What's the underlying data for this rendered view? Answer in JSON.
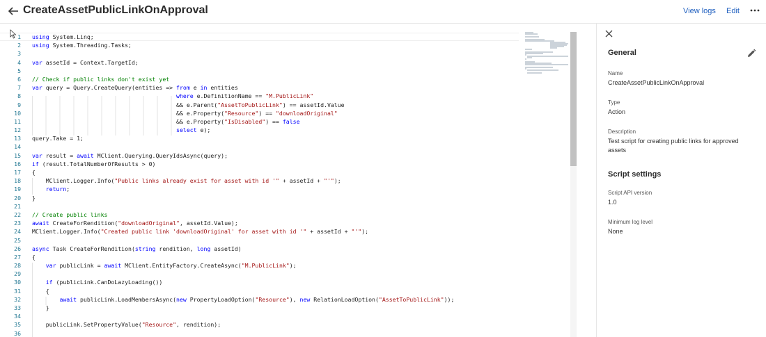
{
  "header": {
    "title": "CreateAssetPublicLinkOnApproval",
    "view_logs": "View logs",
    "edit": "Edit"
  },
  "icons": {
    "back": "arrow-left-icon",
    "more": "more-horizontal-icon",
    "close": "close-icon",
    "edit": "pencil-icon",
    "cursor": "mouse-pointer-icon"
  },
  "editor": {
    "lines": [
      {
        "n": "1",
        "t": "using System.Linq;"
      },
      {
        "n": "2",
        "t": "using System.Threading.Tasks;"
      },
      {
        "n": "3",
        "t": ""
      },
      {
        "n": "4",
        "t": "var assetId = Context.TargetId;"
      },
      {
        "n": "5",
        "t": ""
      },
      {
        "n": "6",
        "t": "// Check if public links don't exist yet"
      },
      {
        "n": "7",
        "t": "var query = Query.CreateQuery(entities => from e in entities"
      },
      {
        "n": "8",
        "t": "                                          where e.DefinitionName == \"M.PublicLink\""
      },
      {
        "n": "9",
        "t": "                                          && e.Parent(\"AssetToPublicLink\") == assetId.Value"
      },
      {
        "n": "10",
        "t": "                                          && e.Property(\"Resource\") == \"downloadOriginal\""
      },
      {
        "n": "11",
        "t": "                                          && e.Property(\"IsDisabled\") == false"
      },
      {
        "n": "12",
        "t": "                                          select e);"
      },
      {
        "n": "13",
        "t": "query.Take = 1;"
      },
      {
        "n": "14",
        "t": ""
      },
      {
        "n": "15",
        "t": "var result = await MClient.Querying.QueryIdsAsync(query);"
      },
      {
        "n": "16",
        "t": "if (result.TotalNumberOfResults > 0)"
      },
      {
        "n": "17",
        "t": "{"
      },
      {
        "n": "18",
        "t": "    MClient.Logger.Info(\"Public links already exist for asset with id '\" + assetId + \"'\");"
      },
      {
        "n": "19",
        "t": "    return;"
      },
      {
        "n": "20",
        "t": "}"
      },
      {
        "n": "21",
        "t": ""
      },
      {
        "n": "22",
        "t": "// Create public links"
      },
      {
        "n": "23",
        "t": "await CreateForRendition(\"downloadOriginal\", assetId.Value);"
      },
      {
        "n": "24",
        "t": "MClient.Logger.Info(\"Created public link 'downloadOriginal' for asset with id '\" + assetId + \"'\");"
      },
      {
        "n": "25",
        "t": ""
      },
      {
        "n": "26",
        "t": "async Task CreateForRendition(string rendition, long assetId)"
      },
      {
        "n": "27",
        "t": "{"
      },
      {
        "n": "28",
        "t": "    var publicLink = await MClient.EntityFactory.CreateAsync(\"M.PublicLink\");"
      },
      {
        "n": "29",
        "t": ""
      },
      {
        "n": "30",
        "t": "    if (publicLink.CanDoLazyLoading())"
      },
      {
        "n": "31",
        "t": "    {"
      },
      {
        "n": "32",
        "t": "        await publicLink.LoadMembersAsync(new PropertyLoadOption(\"Resource\"), new RelationLoadOption(\"AssetToPublicLink\"));"
      },
      {
        "n": "33",
        "t": "    }"
      },
      {
        "n": "34",
        "t": ""
      },
      {
        "n": "35",
        "t": "    publicLink.SetPropertyValue(\"Resource\", rendition);"
      },
      {
        "n": "36",
        "t": ""
      }
    ],
    "colors": {
      "keyword": "#0000ff",
      "string": "#a31515",
      "comment": "#008000",
      "line_number": "#237893"
    }
  },
  "panel": {
    "general_title": "General",
    "name_label": "Name",
    "name_value": "CreateAssetPublicLinkOnApproval",
    "type_label": "Type",
    "type_value": "Action",
    "description_label": "Description",
    "description_value": "Test script for creating public links for approved assets",
    "script_settings_title": "Script settings",
    "api_version_label": "Script API version",
    "api_version_value": "1.0",
    "min_log_label": "Minimum log level",
    "min_log_value": "None"
  }
}
